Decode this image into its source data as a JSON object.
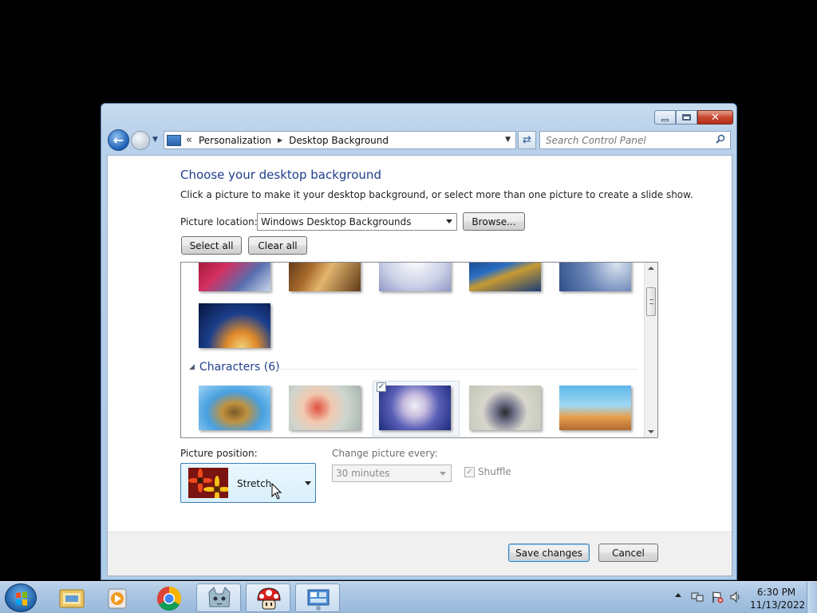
{
  "window": {
    "address": {
      "crumb_chevron": "«",
      "crumbs": [
        "Personalization",
        "Desktop Background"
      ]
    },
    "search": {
      "placeholder": "Search Control Panel"
    }
  },
  "content": {
    "title": "Choose your desktop background",
    "subtitle": "Click a picture to make it your desktop background, or select more than one picture to create a slide show.",
    "location_label": "Picture location:",
    "location_value": "Windows Desktop Backgrounds",
    "browse_label": "Browse...",
    "select_all_label": "Select all",
    "clear_all_label": "Clear all",
    "group_characters": "Characters (6)",
    "position_label": "Picture position:",
    "position_value": "Stretch",
    "interval_label": "Change picture every:",
    "interval_value": "30 minutes",
    "shuffle_label": "Shuffle",
    "save_label": "Save changes",
    "cancel_label": "Cancel"
  },
  "taskbar": {
    "time": "6:30 PM",
    "date": "11/13/2022"
  }
}
